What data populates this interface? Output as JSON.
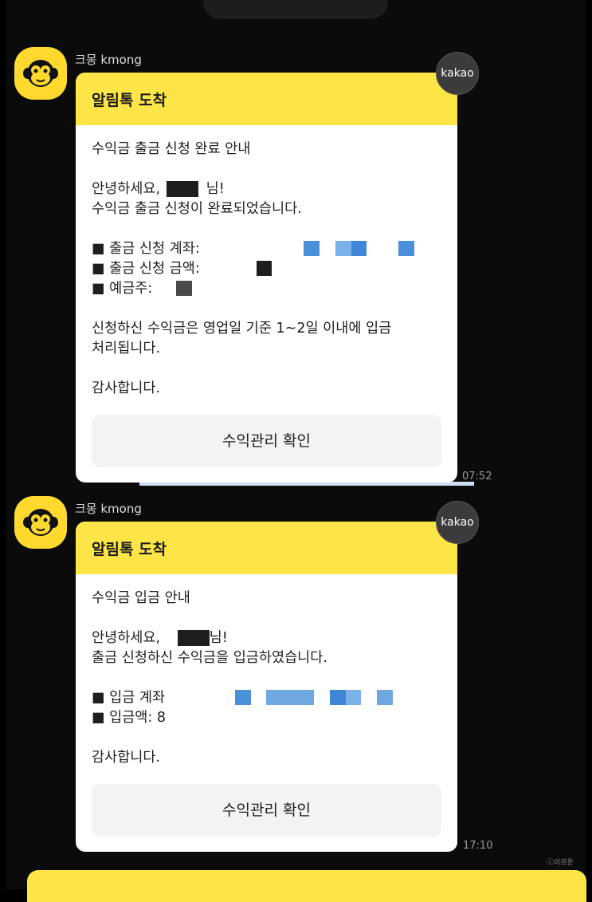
{
  "colors": {
    "alim_header": "#fee547",
    "background": "#0b0b0b",
    "redact_blue": "#4a90d9"
  },
  "messages": [
    {
      "sender": "크몽 kmong",
      "badge": "kakao",
      "header": "알림톡 도착",
      "title": "수익금 출금 신청 완료 안내",
      "greeting_prefix": "안녕하세요,",
      "greeting_suffix": "님!",
      "line2": "수익금 출금 신청이 완료되었습니다.",
      "item1": "■ 출금 신청 계좌:",
      "item2": "■ 출금 신청 금액:",
      "item3": "■ 예금주:",
      "notice1": "신청하신 수익금은 영업일 기준 1~2일 이내에 입금",
      "notice2": "처리됩니다.",
      "thanks": "감사합니다.",
      "button": "수익관리 확인",
      "time": "07:52"
    },
    {
      "sender": "크몽 kmong",
      "badge": "kakao",
      "header": "알림톡 도착",
      "title": "수익금 입금 안내",
      "greeting_prefix": "안녕하세요,",
      "greeting_suffix": "님!",
      "line2": "출금 신청하신 수익금을 입금하였습니다.",
      "item1": "■ 입금 계좌",
      "item2": "■ 입금액: 8",
      "thanks": "감사합니다.",
      "button": "수익관리 확인",
      "time": "17:10"
    }
  ],
  "watermark": "ⓒ이르운"
}
